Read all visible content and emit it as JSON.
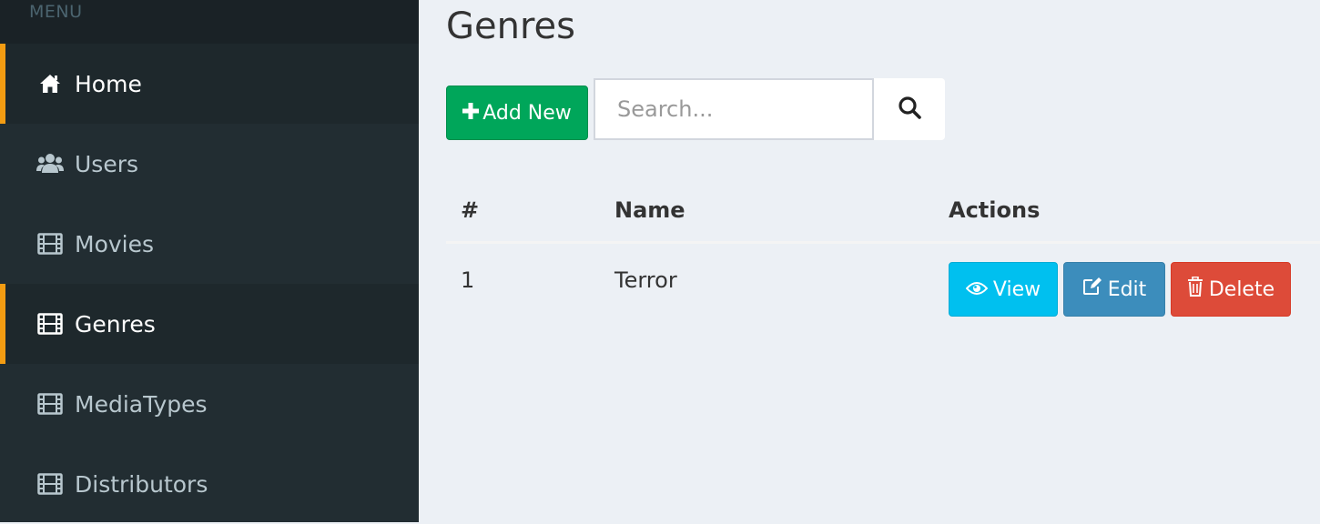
{
  "sidebar": {
    "header": "MENU",
    "items": [
      {
        "label": "Home",
        "icon": "home-icon",
        "active": true
      },
      {
        "label": "Users",
        "icon": "users-icon",
        "active": false
      },
      {
        "label": "Movies",
        "icon": "film-icon",
        "active": false
      },
      {
        "label": "Genres",
        "icon": "film-icon",
        "active": true
      },
      {
        "label": "MediaTypes",
        "icon": "film-icon",
        "active": false
      },
      {
        "label": "Distributors",
        "icon": "film-icon",
        "active": false
      }
    ]
  },
  "main": {
    "title": "Genres",
    "add_button": "Add New",
    "search": {
      "placeholder": "Search...",
      "value": ""
    },
    "table": {
      "headers": [
        "#",
        "Name",
        "Actions"
      ],
      "rows": [
        {
          "num": "1",
          "name": "Terror"
        }
      ],
      "actions": {
        "view": "View",
        "edit": "Edit",
        "delete": "Delete"
      }
    }
  },
  "colors": {
    "sidebar_bg": "#222d32",
    "active_accent": "#f39c12",
    "add_green": "#00a65a",
    "view_cyan": "#00c0ef",
    "edit_blue": "#3c8dbc",
    "delete_red": "#dd4b39"
  }
}
